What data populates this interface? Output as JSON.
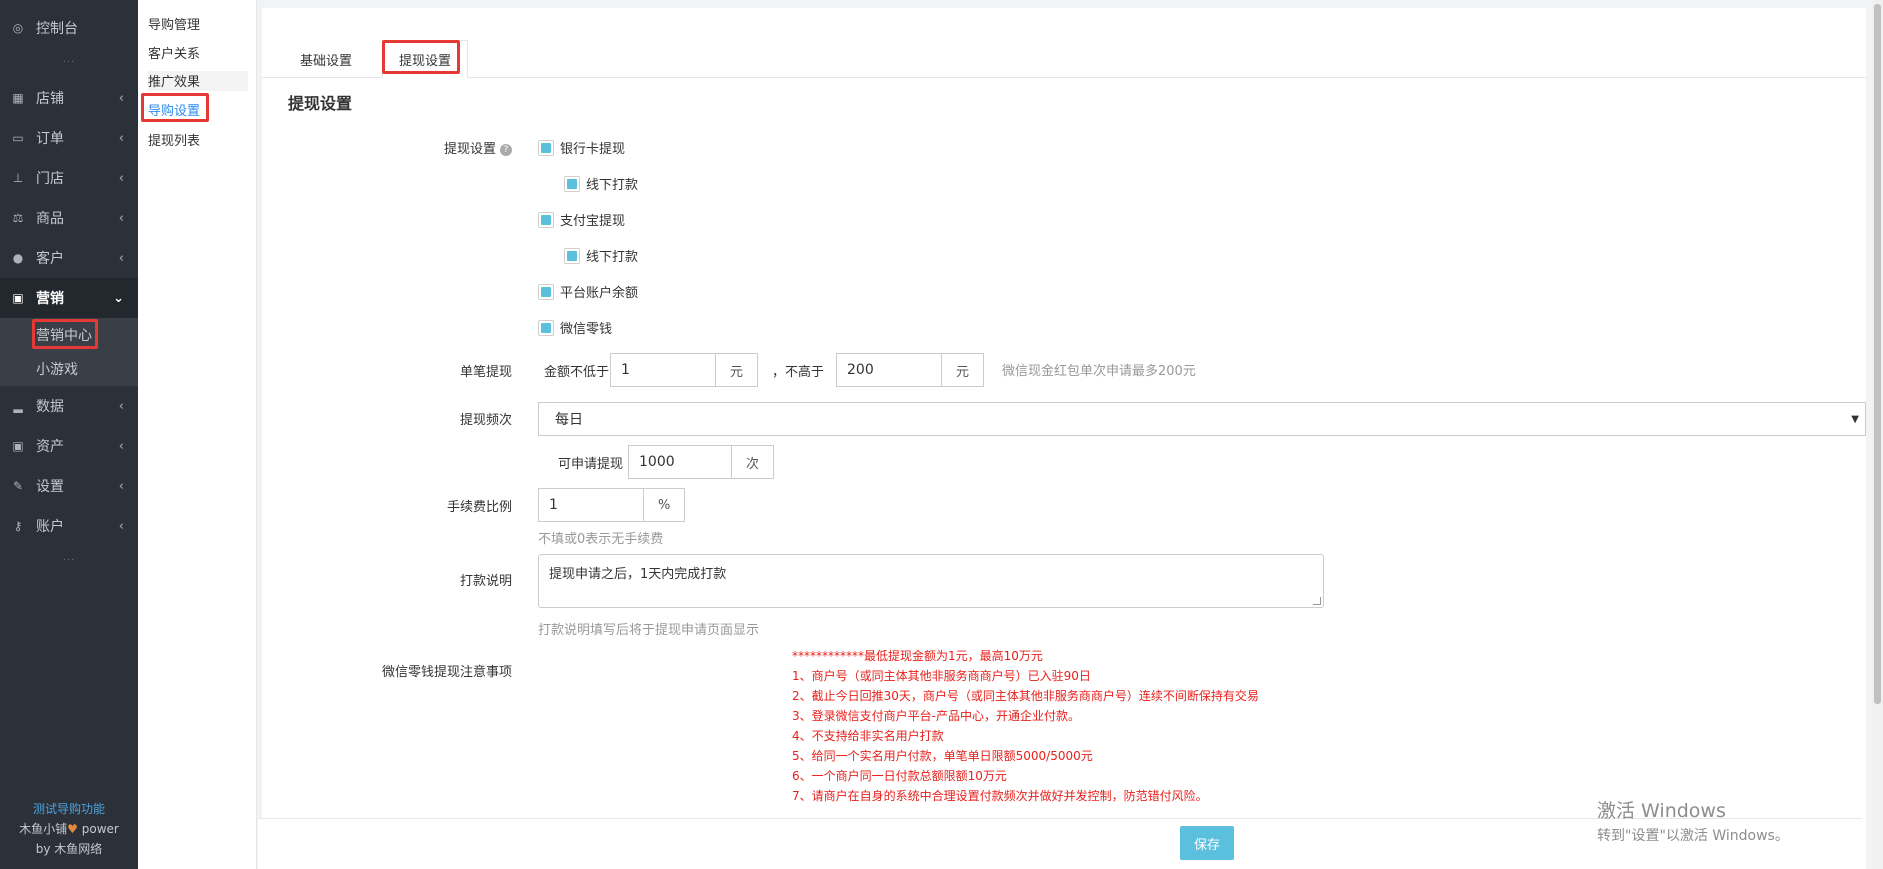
{
  "sidebar": {
    "dashboard": {
      "label": "控制台",
      "icon": "dashboard-icon"
    },
    "items": [
      {
        "label": "店铺",
        "icon": "shop-icon"
      },
      {
        "label": "订单",
        "icon": "order-icon"
      },
      {
        "label": "门店",
        "icon": "store-tree-icon"
      },
      {
        "label": "商品",
        "icon": "scale-icon"
      },
      {
        "label": "客户",
        "icon": "users-icon"
      },
      {
        "label": "营销",
        "icon": "gift-icon"
      },
      {
        "label": "数据",
        "icon": "bar-chart-icon"
      },
      {
        "label": "资产",
        "icon": "money-icon"
      },
      {
        "label": "设置",
        "icon": "wrench-icon"
      },
      {
        "label": "账户",
        "icon": "key-icon"
      }
    ],
    "marketing_sub": [
      {
        "label": "营销中心"
      },
      {
        "label": "小游戏"
      }
    ],
    "dots": "...",
    "footer": {
      "test_link": "测试导购功能",
      "brand": "木鱼小铺",
      "power": "power",
      "by": "by 木鱼网络"
    }
  },
  "submenu": {
    "items": [
      "导购管理",
      "客户关系",
      "推广效果",
      "导购设置",
      "提现列表"
    ]
  },
  "tabs": [
    "基础设置",
    "提现设置"
  ],
  "section_title": "提现设置",
  "form": {
    "withdraw_label": "提现设置",
    "options": {
      "bank": "银行卡提现",
      "bank_offline": "线下打款",
      "alipay": "支付宝提现",
      "alipay_offline": "线下打款",
      "balance": "平台账户余额",
      "wechat": "微信零钱"
    },
    "single": {
      "label": "单笔提现",
      "min_prefix": "金额不低于",
      "min_value": "1",
      "unit": "元",
      "max_prefix": "，不高于",
      "max_value": "200",
      "hint": "微信现金红包单次申请最多200元"
    },
    "frequency": {
      "label": "提现频次",
      "selected": "每日",
      "times_prefix": "可申请提现",
      "times_value": "1000",
      "times_unit": "次"
    },
    "fee": {
      "label": "手续费比例",
      "value": "1",
      "unit": "%",
      "hint": "不填或0表示无手续费"
    },
    "payment_note": {
      "label": "打款说明",
      "value": "提现申请之后，1天内完成打款",
      "hint": "打款说明填写后将于提现申请页面显示"
    },
    "wechat_notice": {
      "label": "微信零钱提现注意事项",
      "lines": [
        "************最低提现金额为1元，最高10万元",
        "1、商户号（或同主体其他非服务商商户号）已入驻90日",
        "2、截止今日回推30天，商户号（或同主体其他非服务商商户号）连续不间断保持有交易",
        "3、登录微信支付商户平台-产品中心，开通企业付款。",
        "4、不支持给非实名用户打款",
        "5、给同一个实名用户付款，单笔单日限额5000/5000元",
        "6、一个商户同一日付款总额限额10万元",
        "7、请商户在自身的系统中合理设置付款频次并做好并发控制，防范错付风险。"
      ]
    }
  },
  "save_label": "保存",
  "watermark": {
    "line1": "激活 Windows",
    "line2": "转到\"设置\"以激活 Windows。"
  },
  "colors": {
    "sidebar_bg": "#2c3038",
    "accent_link": "#2d8cf0",
    "checkbox_fill": "#5bc0de",
    "notice_red": "#e8211c",
    "highlight_red": "#e53935"
  }
}
